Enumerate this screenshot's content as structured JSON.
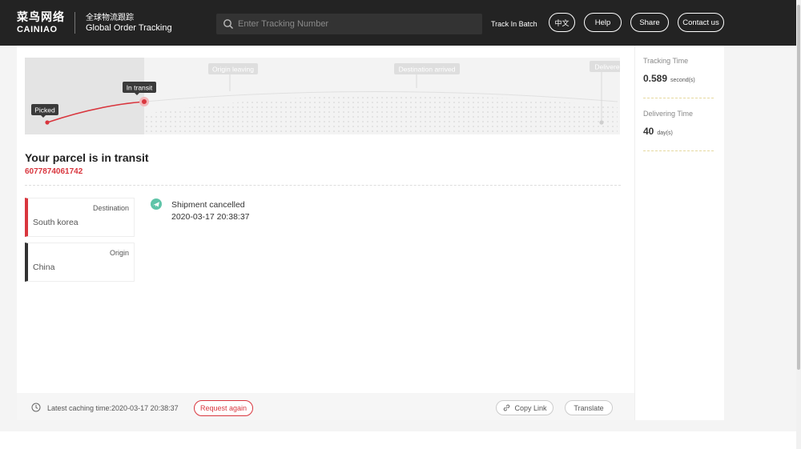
{
  "header": {
    "logo_cn": "菜鸟网络",
    "logo_en": "CAINIAO",
    "sub_cn": "全球物流跟踪",
    "sub_en": "Global Order Tracking",
    "search_placeholder": "Enter Tracking Number",
    "track_batch": "Track In Batch",
    "lang_label": "中文",
    "help_label": "Help",
    "share_label": "Share",
    "contact_label": "Contact us"
  },
  "progress": {
    "stages": [
      "Picked",
      "In transit",
      "Origin leaving",
      "Destination arrived",
      "Delivere"
    ],
    "current_stage": "In transit",
    "accent_color": "#d9363e"
  },
  "parcel": {
    "status_title": "Your parcel is in transit",
    "tracking_number": "6077874061742"
  },
  "locations": {
    "destination_label": "Destination",
    "destination_value": "South korea",
    "origin_label": "Origin",
    "origin_value": "China"
  },
  "events": [
    {
      "icon": "airplane-icon",
      "title": "Shipment cancelled",
      "time": "2020-03-17 20:38:37"
    }
  ],
  "footer": {
    "cache_text": "Latest caching time:2020-03-17 20:38:37",
    "request_again": "Request again",
    "copy_link": "Copy Link",
    "translate": "Translate"
  },
  "stats": {
    "tracking_time_label": "Tracking Time",
    "tracking_time_value": "0.589",
    "tracking_time_unit": "second(s)",
    "delivering_time_label": "Delivering Time",
    "delivering_time_value": "40",
    "delivering_time_unit": "day(s)"
  }
}
